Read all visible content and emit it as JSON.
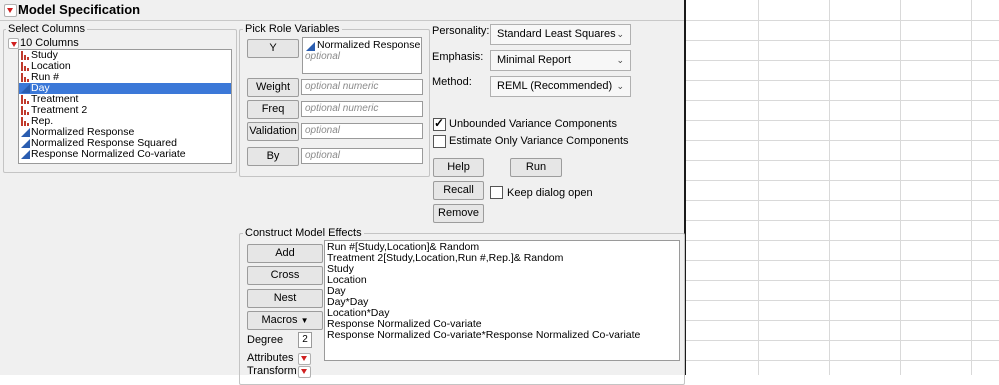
{
  "window": {
    "title": "Model Specification"
  },
  "select_columns": {
    "group_label": "Select Columns",
    "count_label": "10 Columns",
    "columns": [
      {
        "label": "Study",
        "icon": "nominal-icon",
        "selected": false
      },
      {
        "label": "Location",
        "icon": "nominal-icon",
        "selected": false
      },
      {
        "label": "Run #",
        "icon": "nominal-icon",
        "selected": false
      },
      {
        "label": "Day",
        "icon": "continuous-icon",
        "selected": true
      },
      {
        "label": "Treatment",
        "icon": "nominal-icon",
        "selected": false
      },
      {
        "label": "Treatment 2",
        "icon": "nominal-icon",
        "selected": false
      },
      {
        "label": "Rep.",
        "icon": "nominal-icon",
        "selected": false
      },
      {
        "label": "Normalized Response",
        "icon": "continuous-icon",
        "selected": false
      },
      {
        "label": "Normalized Response Squared",
        "icon": "continuous-icon",
        "selected": false
      },
      {
        "label": "Response Normalized Co-variate",
        "icon": "continuous-icon",
        "selected": false
      }
    ]
  },
  "pick_role": {
    "group_label": "Pick Role Variables",
    "y_button": "Y",
    "y_value": "Normalized Response S",
    "y_placeholder": "optional",
    "weight_button": "Weight",
    "weight_placeholder": "optional numeric",
    "freq_button": "Freq",
    "freq_placeholder": "optional numeric",
    "validation_button": "Validation",
    "validation_placeholder": "optional",
    "by_button": "By",
    "by_placeholder": "optional"
  },
  "settings": {
    "personality_label": "Personality:",
    "personality_value": "Standard Least Squares",
    "emphasis_label": "Emphasis:",
    "emphasis_value": "Minimal Report",
    "method_label": "Method:",
    "method_value": "REML (Recommended)",
    "unbounded_label": "Unbounded Variance Components",
    "unbounded_checked": true,
    "estimate_only_label": "Estimate Only Variance Components",
    "estimate_only_checked": false
  },
  "actions": {
    "help": "Help",
    "run": "Run",
    "recall": "Recall",
    "keep_open_label": "Keep dialog open",
    "remove": "Remove"
  },
  "construct": {
    "group_label": "Construct Model Effects",
    "add": "Add",
    "cross": "Cross",
    "nest": "Nest",
    "macros": "Macros",
    "degree_label": "Degree",
    "degree_value": "2",
    "attributes_label": "Attributes",
    "transform_label": "Transform",
    "effects": [
      "Run #[Study,Location]& Random",
      "Treatment 2[Study,Location,Run #,Rep.]& Random",
      "Study",
      "Location",
      "Day",
      "Day*Day",
      "Location*Day",
      "Response Normalized Co-variate",
      "Response Normalized Co-variate*Response Normalized Co-variate"
    ]
  }
}
